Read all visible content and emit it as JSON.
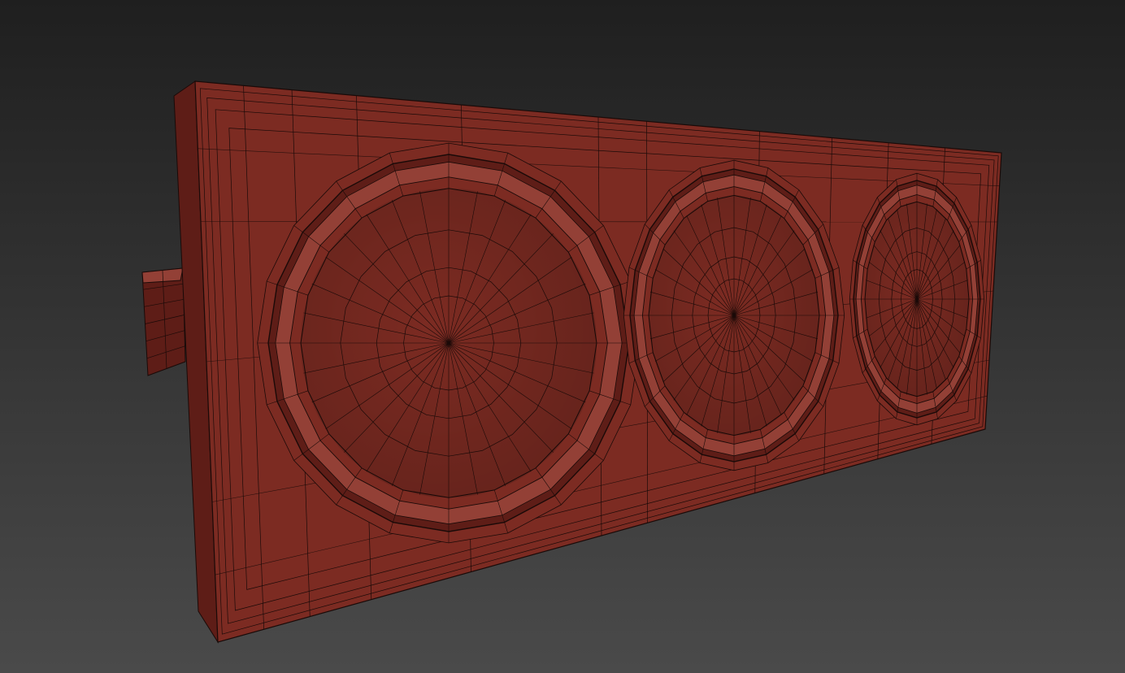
{
  "scene": {
    "subject": "three-gauge-panel-mesh",
    "gauges": 3
  },
  "colors": {
    "background_top": "#1f1f1f",
    "background_bottom": "#4a4a4a",
    "mesh_fill": "#7c2b22",
    "mesh_fill_light": "#934036",
    "mesh_fill_dark": "#5e1d17",
    "wire": "#1a0a08"
  }
}
